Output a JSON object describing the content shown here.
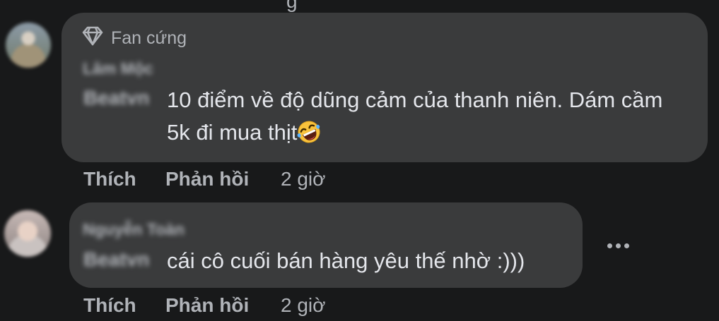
{
  "comments": [
    {
      "badge": "Fan cứng",
      "author_name": "Lâm Mộc",
      "mention": "Beatvn",
      "text": "10 điểm về độ dũng cảm của thanh niên. Dám cầm 5k đi mua thịt",
      "emoji_icon": "rolling-laughing-emoji",
      "actions": {
        "like": "Thích",
        "reply": "Phản hồi",
        "time": "2 giờ"
      }
    },
    {
      "author_name": "Nguyễn Toàn",
      "mention": "Beatvn",
      "text": "cái cô cuối bán hàng yêu thế nhờ :)))",
      "actions": {
        "like": "Thích",
        "reply": "Phản hồi",
        "time": "2 giờ"
      }
    }
  ],
  "colors": {
    "background": "#18191a",
    "bubble": "#3a3b3c",
    "primary_text": "#e4e6eb",
    "secondary_text": "#b0b3b8"
  }
}
